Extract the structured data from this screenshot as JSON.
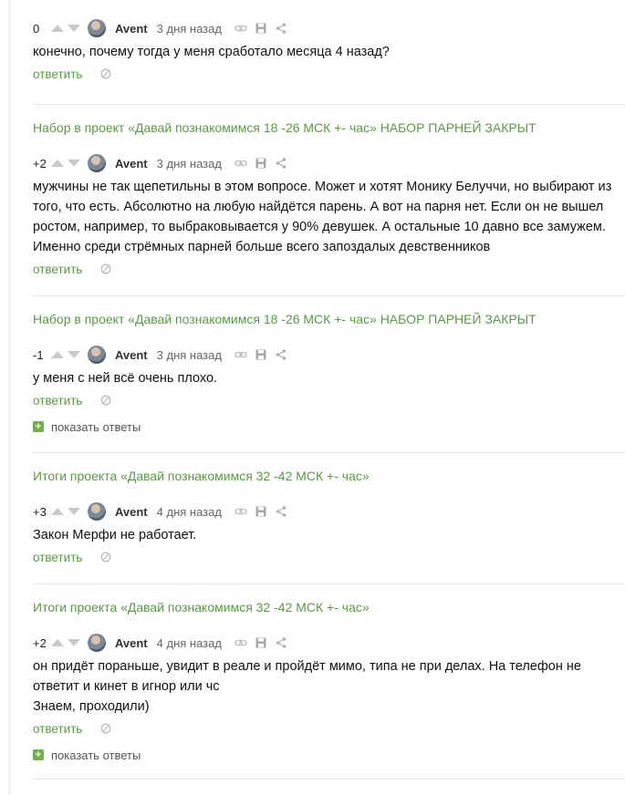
{
  "colors": {
    "accent": "#5a9a45",
    "plus_box": "#6fb14c",
    "arrow": "#c9c9c9",
    "divider": "#e6e6e6"
  },
  "icons": {
    "vote_up": "triangle-up-icon",
    "vote_down": "triangle-down-icon",
    "link": "link-icon",
    "save": "floppy-disk-icon",
    "share": "share-icon",
    "hide": "hide-circle-slash-icon",
    "expand": "plus-box-icon"
  },
  "comments": [
    {
      "story_title": "",
      "rating": "0",
      "author": "Avent",
      "date": "3 дня назад",
      "body": [
        "конечно, почему тогда у меня сработало месяца 4 назад?"
      ],
      "reply_label": "ответить",
      "show_replies": ""
    },
    {
      "story_title": "Набор в проект «Давай познакомимся 18 -26 МСК +- час» НАБОР ПАРНЕЙ ЗАКРЫТ",
      "rating": "+2",
      "author": "Avent",
      "date": "3 дня назад",
      "body": [
        "мужчины не так щепетильны в этом вопросе. Может и хотят Монику Белуччи, но выбирают из того, что есть. Абсолютно на любую найдётся парень. А вот на парня нет. Если он не вышел ростом, например, то выбраковывается у 90% девушек. А остальные 10 давно все замужем. Именно среди стрёмных парней больше всего запоздалых девственников"
      ],
      "reply_label": "ответить",
      "show_replies": ""
    },
    {
      "story_title": "Набор в проект «Давай познакомимся 18 -26 МСК +- час» НАБОР ПАРНЕЙ ЗАКРЫТ",
      "rating": "-1",
      "author": "Avent",
      "date": "3 дня назад",
      "body": [
        "у меня с ней всё очень плохо."
      ],
      "reply_label": "ответить",
      "show_replies": "показать ответы"
    },
    {
      "story_title": "Итоги проекта «Давай познакомимся 32 -42 МСК +- час»",
      "rating": "+3",
      "author": "Avent",
      "date": "4 дня назад",
      "body": [
        "Закон Мерфи не работает."
      ],
      "reply_label": "ответить",
      "show_replies": ""
    },
    {
      "story_title": "Итоги проекта «Давай познакомимся 32 -42 МСК +- час»",
      "rating": "+2",
      "author": "Avent",
      "date": "4 дня назад",
      "body": [
        "он придёт пораньше, увидит в реале и пройдёт мимо, типа не при делах. На телефон не ответит и кинет в игнор или чс",
        "Знаем, проходили)"
      ],
      "reply_label": "ответить",
      "show_replies": "показать ответы"
    }
  ]
}
